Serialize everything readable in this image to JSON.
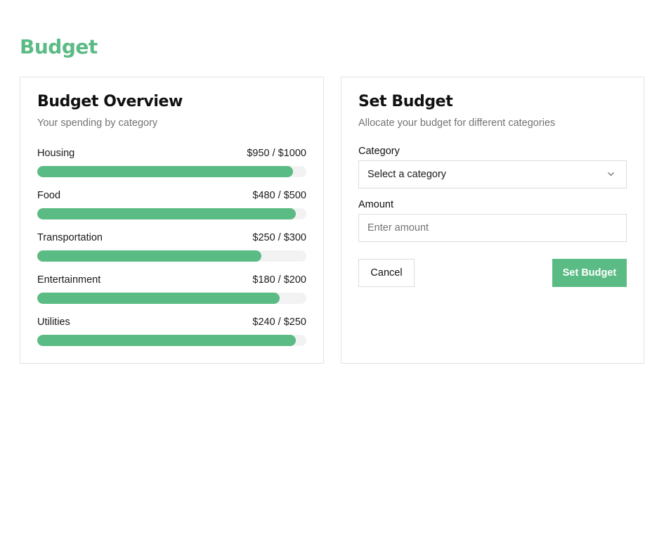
{
  "page": {
    "title": "Budget"
  },
  "colors": {
    "accent": "#5bbb85",
    "track": "#f2f2f2",
    "border": "#e3e3e3"
  },
  "overview": {
    "title": "Budget Overview",
    "subtitle": "Your spending by category",
    "items": [
      {
        "label": "Housing",
        "amount": "$950 / $1000",
        "spent": 950,
        "limit": 1000
      },
      {
        "label": "Food",
        "amount": "$480 / $500",
        "spent": 480,
        "limit": 500
      },
      {
        "label": "Transportation",
        "amount": "$250 / $300",
        "spent": 250,
        "limit": 300
      },
      {
        "label": "Entertainment",
        "amount": "$180 / $200",
        "spent": 180,
        "limit": 200
      },
      {
        "label": "Utilities",
        "amount": "$240 / $250",
        "spent": 240,
        "limit": 250
      }
    ]
  },
  "form": {
    "title": "Set Budget",
    "subtitle": "Allocate your budget for different categories",
    "category_label": "Category",
    "category_value": "Select a category",
    "category_icon": "chevron-down-icon",
    "amount_label": "Amount",
    "amount_placeholder": "Enter amount",
    "amount_value": "",
    "cancel_label": "Cancel",
    "submit_label": "Set Budget"
  }
}
